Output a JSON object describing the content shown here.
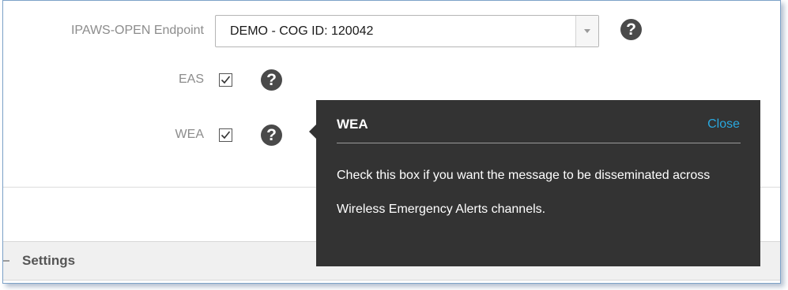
{
  "endpoint": {
    "label": "IPAWS-OPEN Endpoint",
    "selected_value": "DEMO - COG ID: 120042"
  },
  "eas": {
    "label": "EAS",
    "checked": true
  },
  "wea": {
    "label": "WEA",
    "checked": true
  },
  "help_glyph": "?",
  "popover": {
    "title": "WEA",
    "close_label": "Close",
    "body": "Check this box if you want the message to be disseminated across Wireless Emergency Alerts channels."
  },
  "section": {
    "title": "Settings"
  },
  "colors": {
    "popover_bg": "#333333",
    "close_link": "#29a8df",
    "help_icon": "#4a4a4a",
    "frame_border": "#7da2c8"
  }
}
